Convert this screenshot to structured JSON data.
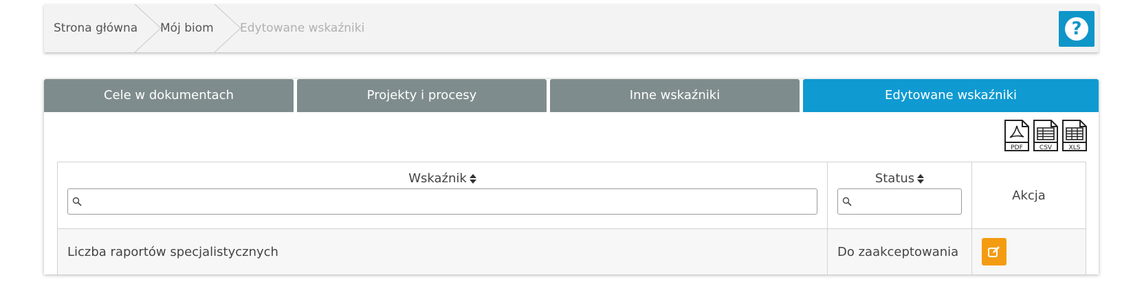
{
  "breadcrumb": {
    "items": [
      {
        "label": "Strona główna"
      },
      {
        "label": "Mój biom"
      },
      {
        "label": "Edytowane wskaźniki"
      }
    ],
    "help_icon": "question-circle-icon",
    "help_glyph": "?"
  },
  "tabs": [
    {
      "label": "Cele w dokumentach",
      "active": false
    },
    {
      "label": "Projekty i procesy",
      "active": false
    },
    {
      "label": "Inne wskaźniki",
      "active": false
    },
    {
      "label": "Edytowane wskaźniki",
      "active": true
    }
  ],
  "exports": [
    {
      "label": "PDF",
      "icon": "pdf-file-icon"
    },
    {
      "label": "CSV",
      "icon": "csv-file-icon"
    },
    {
      "label": "XLS",
      "icon": "xls-file-icon"
    }
  ],
  "table": {
    "columns": {
      "indicator": "Wskaźnik",
      "status": "Status",
      "action": "Akcja"
    },
    "filters": {
      "indicator": {
        "value": "",
        "placeholder": ""
      },
      "status": {
        "value": "",
        "placeholder": ""
      }
    },
    "rows": [
      {
        "indicator": "Liczba raportów specjalistycznych",
        "status": "Do zaakceptowania",
        "action_icon": "edit-icon"
      }
    ]
  },
  "colors": {
    "tab_inactive": "#7f8c8d",
    "tab_active": "#0f9ad2",
    "help_button": "#0f96c8",
    "edit_button": "#f39c12"
  }
}
